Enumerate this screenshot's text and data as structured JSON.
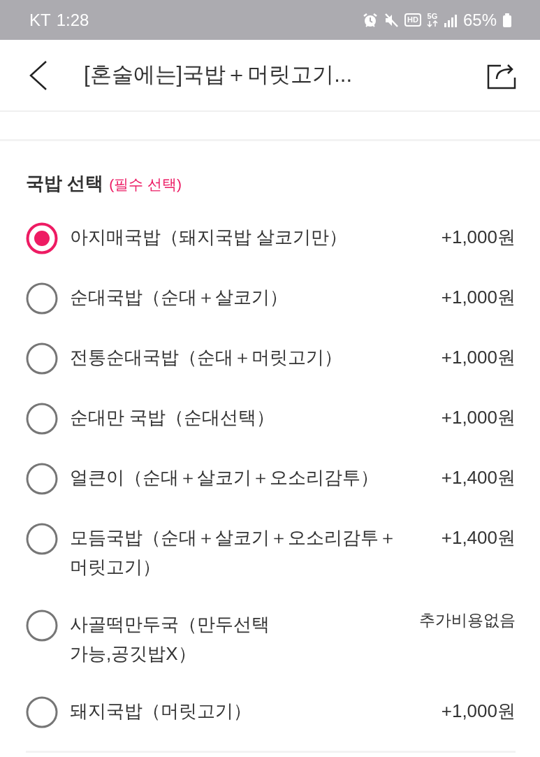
{
  "status_bar": {
    "carrier": "KT",
    "time": "1:28",
    "hd_label": "HD",
    "network_label": "5G",
    "battery_percent": "65%"
  },
  "header": {
    "title": "[혼술에는]국밥＋머릿고기..."
  },
  "section": {
    "title": "국밥 선택",
    "required_note": "(필수 선택)"
  },
  "options": [
    {
      "label": "아지매국밥（돼지국밥 살코기만）",
      "price": "+1,000원",
      "kind": "surcharge",
      "selected": true
    },
    {
      "label": "순대국밥（순대＋살코기）",
      "price": "+1,000원",
      "kind": "surcharge",
      "selected": false
    },
    {
      "label": "전통순대국밥（순대＋머릿고기）",
      "price": "+1,000원",
      "kind": "surcharge",
      "selected": false
    },
    {
      "label": "순대만 국밥（순대선택）",
      "price": "+1,000원",
      "kind": "surcharge",
      "selected": false
    },
    {
      "label": "얼큰이（순대＋살코기＋오소리감투）",
      "price": "+1,400원",
      "kind": "surcharge",
      "selected": false
    },
    {
      "label": "모듬국밥（순대＋살코기＋오소리감투＋머릿고기）",
      "price": "+1,400원",
      "kind": "surcharge",
      "selected": false
    },
    {
      "label": "사골떡만두국（만두선택 가능,공깃밥X）",
      "price": "추가비용없음",
      "kind": "free",
      "selected": false
    },
    {
      "label": "돼지국밥（머릿고기）",
      "price": "+1,000원",
      "kind": "surcharge",
      "selected": false
    }
  ]
}
